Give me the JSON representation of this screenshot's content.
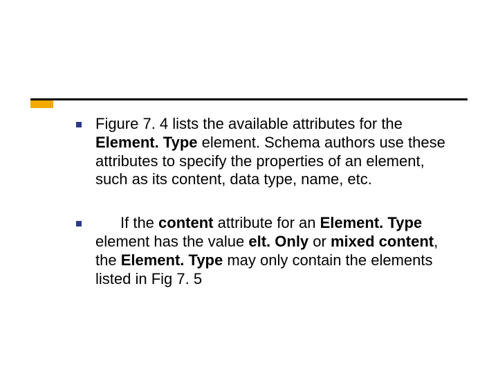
{
  "accent_color": "#f2a900",
  "bullets": [
    {
      "segments": [
        {
          "t": "Figure 7. 4 lists the available attributes for the "
        },
        {
          "t": "Element. Type",
          "b": true
        },
        {
          "t": " element. Schema authors use these attributes to specify the properties of an element, such as its content, data type, name, etc."
        }
      ]
    },
    {
      "lead_indent": true,
      "segments": [
        {
          "t": "If the "
        },
        {
          "t": "content",
          "b": true
        },
        {
          "t": " attribute for an "
        },
        {
          "t": "Element. Type",
          "b": true
        },
        {
          "t": " element has the value "
        },
        {
          "t": "elt. Only",
          "b": true
        },
        {
          "t": " or "
        },
        {
          "t": "mixed content",
          "b": true
        },
        {
          "t": ", the "
        },
        {
          "t": "Element. Type",
          "b": true
        },
        {
          "t": " may only contain the elements listed in Fig 7. 5"
        }
      ]
    }
  ]
}
